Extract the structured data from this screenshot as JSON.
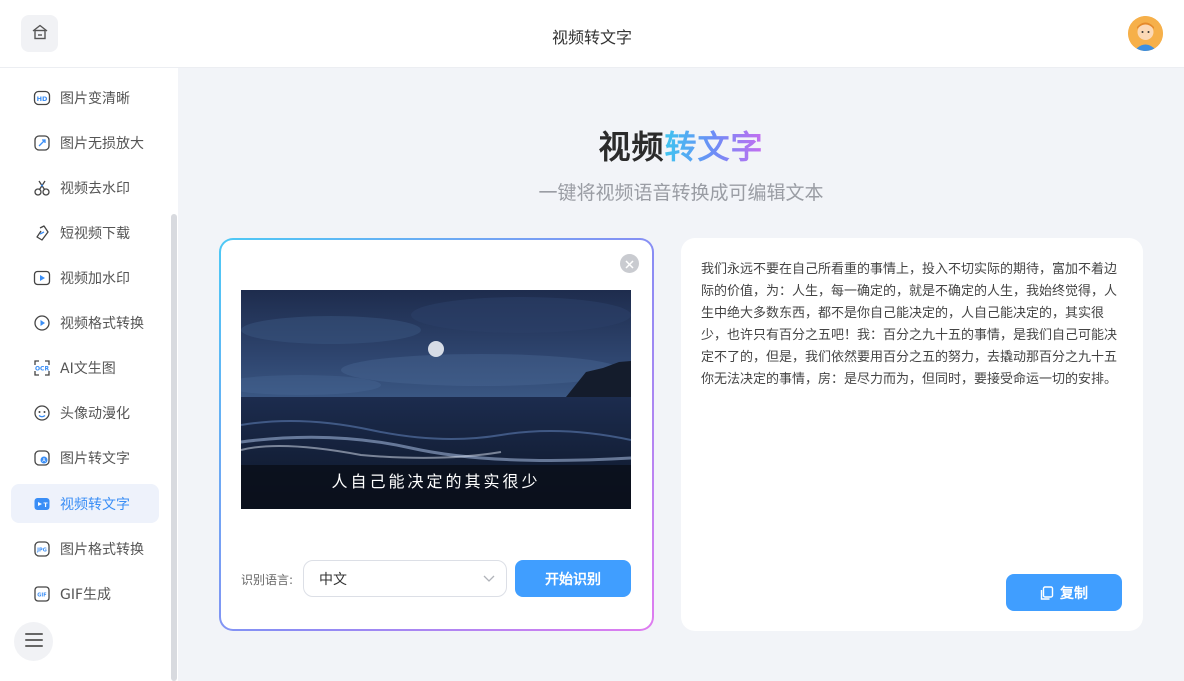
{
  "header": {
    "title": "视频转文字"
  },
  "sidebar": {
    "items": [
      {
        "label": "图片变清晰",
        "icon": "hd-icon"
      },
      {
        "label": "图片无损放大",
        "icon": "enlarge-icon"
      },
      {
        "label": "视频去水印",
        "icon": "scissors-icon"
      },
      {
        "label": "短视频下载",
        "icon": "download-link-icon"
      },
      {
        "label": "视频加水印",
        "icon": "video-watermark-icon"
      },
      {
        "label": "视频格式转换",
        "icon": "play-circle-icon"
      },
      {
        "label": "AI文生图",
        "icon": "ai-scan-icon"
      },
      {
        "label": "头像动漫化",
        "icon": "face-icon"
      },
      {
        "label": "图片转文字",
        "icon": "image-text-icon"
      },
      {
        "label": "视频转文字",
        "icon": "video-text-icon",
        "active": true
      },
      {
        "label": "图片格式转换",
        "icon": "image-format-icon"
      },
      {
        "label": "GIF生成",
        "icon": "gif-icon"
      }
    ]
  },
  "main": {
    "title_part1": "视频",
    "title_part2": "转文字",
    "subtitle": "一键将视频语音转换成可编辑文本"
  },
  "upload": {
    "video_subtitle": "人自己能决定的其实很少",
    "lang_label": "识别语言:",
    "lang_value": "中文",
    "start_button": "开始识别"
  },
  "result": {
    "text": "我们永远不要在自己所看重的事情上，投入不切实际的期待，富加不着边际的价值，为：人生，每一确定的，就是不确定的人生，我始终觉得，人生中绝大多数东西，都不是你自己能决定的，人自己能决定的，其实很少，也许只有百分之五吧！我：百分之九十五的事情，是我们自己可能决定不了的，但是，我们依然要用百分之五的努力，去撬动那百分之九十五你无法决定的事情，房：是尽力而为，但同时，要接受命运一切的安排。",
    "copy_button": "复制"
  },
  "colors": {
    "accent": "#409eff",
    "active_bg": "#eef2fb",
    "active_text": "#3a8ef6"
  }
}
